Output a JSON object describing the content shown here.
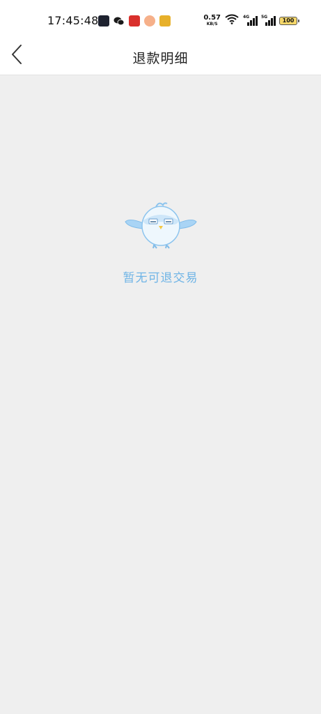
{
  "status_bar": {
    "time": "17:45:48",
    "network_speed_value": "0.57",
    "network_speed_unit": "KB/S",
    "signal_1_label": "4G",
    "signal_2_label": "5G",
    "battery_level": "100",
    "notification_icons": [
      "mail-icon",
      "wechat-icon",
      "red-app-icon",
      "orange-app-icon",
      "yellow-app-icon"
    ]
  },
  "nav": {
    "title": "退款明细",
    "back_icon": "chevron-left-icon"
  },
  "empty_state": {
    "message": "暂无可退交易",
    "illustration": "bird-mascot"
  },
  "colors": {
    "background": "#efefef",
    "header_background": "#ffffff",
    "empty_text": "#6fb4e6",
    "mascot_blue": "#a9d4f5"
  }
}
